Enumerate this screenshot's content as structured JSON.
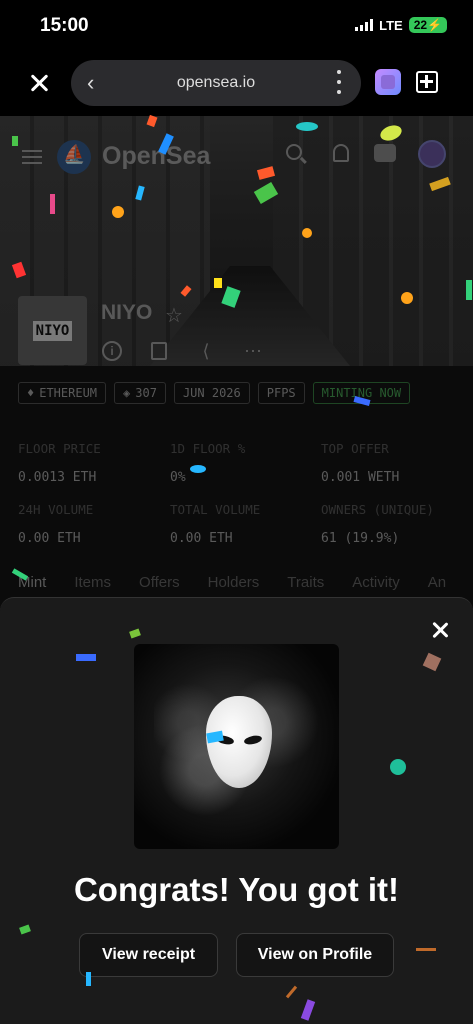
{
  "status_bar": {
    "time": "15:00",
    "network": "LTE",
    "battery": "22"
  },
  "browser": {
    "url": "opensea.io"
  },
  "header": {
    "brand": "OpenSea"
  },
  "collection": {
    "logo_text": "NIYO",
    "name": "NIYO",
    "chips": [
      {
        "icon": "ethereum-icon",
        "label": "ETHEREUM"
      },
      {
        "icon": "layers-icon",
        "label": "307"
      },
      {
        "label": "JUN 2026"
      },
      {
        "label": "PFPS"
      },
      {
        "label": "MINTING NOW"
      }
    ],
    "stats": [
      {
        "label": "FLOOR PRICE",
        "value": "0.0013 ETH"
      },
      {
        "label": "1D FLOOR %",
        "value": "0%"
      },
      {
        "label": "TOP OFFER",
        "value": "0.001 WETH"
      },
      {
        "label": "24H VOLUME",
        "value": "0.00 ETH"
      },
      {
        "label": "TOTAL VOLUME",
        "value": "0.00 ETH"
      },
      {
        "label": "OWNERS (UNIQUE)",
        "value": "61 (19.9%)"
      }
    ],
    "tabs": [
      "Mint",
      "Items",
      "Offers",
      "Holders",
      "Traits",
      "Activity",
      "An"
    ]
  },
  "modal": {
    "title": "Congrats! You got it!",
    "receipt_button": "View receipt",
    "profile_button": "View on Profile"
  }
}
